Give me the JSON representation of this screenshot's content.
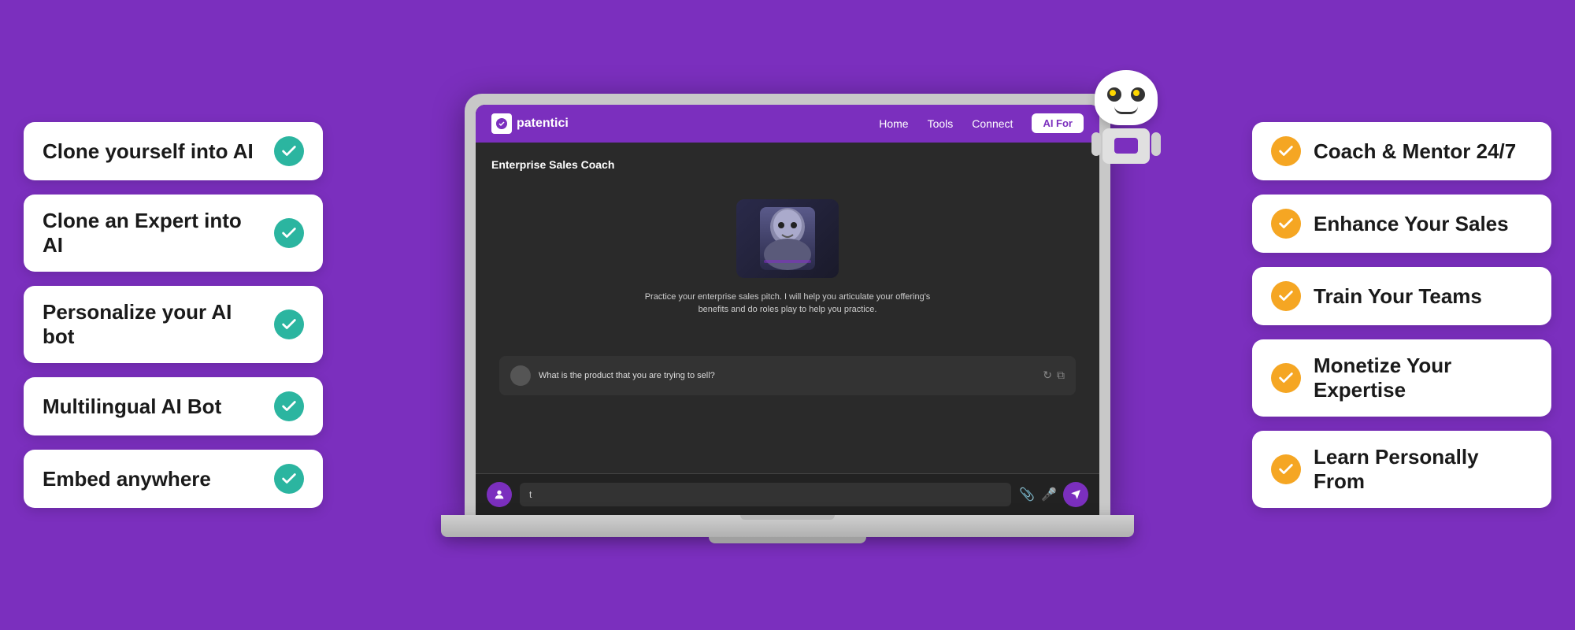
{
  "background_color": "#7B2FBE",
  "left_features": [
    {
      "id": "clone-yourself",
      "label": "Clone yourself into AI",
      "check_color": "teal"
    },
    {
      "id": "clone-expert",
      "label": "Clone an Expert into AI",
      "check_color": "teal"
    },
    {
      "id": "personalize-bot",
      "label": "Personalize your AI bot",
      "check_color": "teal"
    },
    {
      "id": "multilingual",
      "label": "Multilingual AI Bot",
      "check_color": "teal"
    },
    {
      "id": "embed-anywhere",
      "label": "Embed anywhere",
      "check_color": "teal"
    }
  ],
  "right_features": [
    {
      "id": "coach-mentor",
      "label": "Coach & Mentor 24/7",
      "check_color": "orange"
    },
    {
      "id": "enhance-sales",
      "label": "Enhance Your Sales",
      "check_color": "orange"
    },
    {
      "id": "train-teams",
      "label": "Train Your Teams",
      "check_color": "orange"
    },
    {
      "id": "monetize",
      "label": "Monetize Your Expertise",
      "check_color": "orange"
    },
    {
      "id": "learn-personally",
      "label": "Learn Personally From",
      "check_color": "orange"
    }
  ],
  "app": {
    "logo_text": "patentici",
    "nav_items": [
      "Home",
      "Tools",
      "Connect"
    ],
    "ai_button_label": "AI For",
    "chat_title": "Enterprise Sales Coach",
    "chat_description": "Practice your enterprise sales pitch. I will help you articulate your offering's benefits and do roles play to help you practice.",
    "chat_placeholder": "What is the product that you are trying to sell?",
    "bottom_input_placeholder": "t"
  },
  "robot": {
    "alt": "AI Robot Mascot"
  }
}
